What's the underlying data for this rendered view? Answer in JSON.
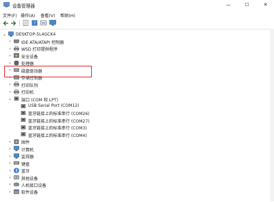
{
  "window": {
    "title": "设备管理器",
    "minimize": "—",
    "maximize": "☐",
    "close": "✕"
  },
  "menu": [
    "文件(F)",
    "操作(A)",
    "查看(V)",
    "帮助(H)"
  ],
  "toolbar_icons": [
    "back-arrow-icon",
    "forward-arrow-icon",
    "properties-icon",
    "help-icon",
    "scan-icon",
    "monitor-icon"
  ],
  "tree": {
    "root": "DESKTOP-5L4GCK4",
    "categories": [
      {
        "label": "IDE ATA/ATAPI 控制器",
        "icon": "ide-icon"
      },
      {
        "label": "WSD 打印提供程序",
        "icon": "printer-icon"
      },
      {
        "label": "安全设备",
        "icon": "security-icon"
      },
      {
        "label": "处理器",
        "icon": "cpu-icon"
      },
      {
        "label": "磁盘驱动器",
        "icon": "disk-icon"
      },
      {
        "label": "存储控制器",
        "icon": "storage-icon"
      },
      {
        "label": "打印队列",
        "icon": "printer-icon"
      },
      {
        "label": "打印机",
        "icon": "printer-icon"
      },
      {
        "label": "端口 (COM 和 LPT)",
        "icon": "port-icon",
        "expanded": true,
        "children": [
          "USB Serial Port (COM12)",
          "蓝牙链接上的标准串行 (COM26)",
          "蓝牙链接上的标准串行 (COM27)",
          "蓝牙链接上的标准串行 (COM3)",
          "蓝牙链接上的标准串行 (COM4)"
        ]
      },
      {
        "label": "固件",
        "icon": "firmware-icon"
      },
      {
        "label": "计算机",
        "icon": "computer-icon"
      },
      {
        "label": "监视器",
        "icon": "monitor-icon"
      },
      {
        "label": "键盘",
        "icon": "keyboard-icon"
      },
      {
        "label": "蓝牙",
        "icon": "bluetooth-icon"
      },
      {
        "label": "其他设备",
        "icon": "other-device-icon"
      },
      {
        "label": "人机接口设备",
        "icon": "hid-icon"
      },
      {
        "label": "软件设备",
        "icon": "software-icon"
      }
    ]
  },
  "colors": {
    "highlight": "#e3262a",
    "bluetooth": "#1f6fd1"
  }
}
